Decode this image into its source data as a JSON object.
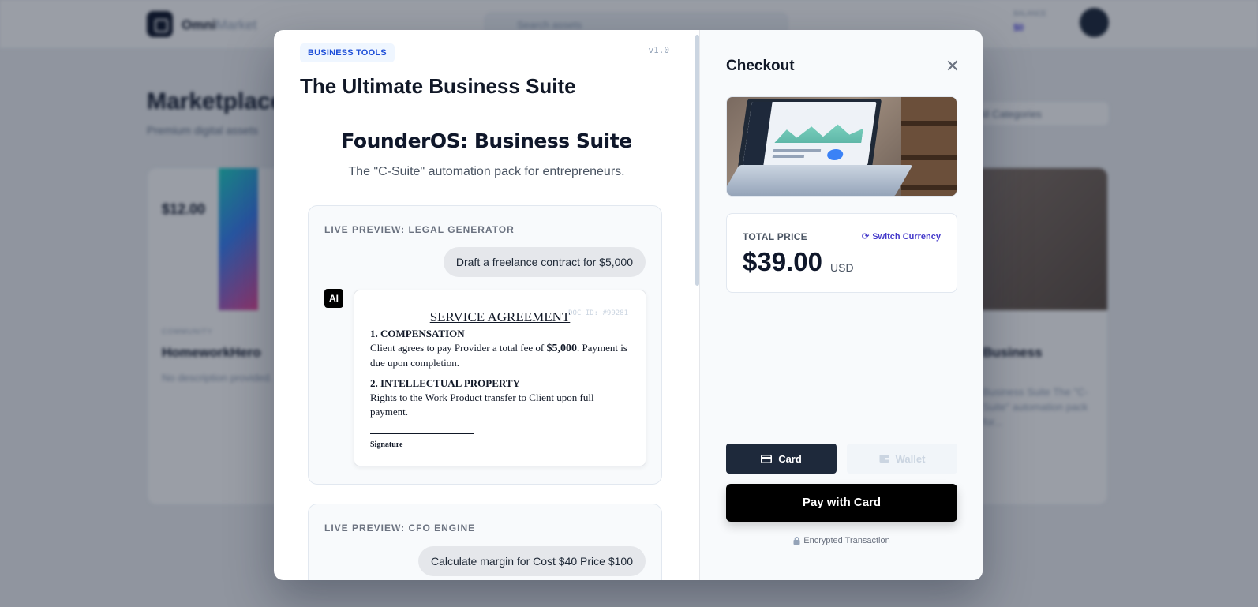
{
  "background": {
    "brand_name": "Omni",
    "brand_suffix": "Market",
    "search_placeholder": "Search assets",
    "balance_label": "BALANCE",
    "balance_value": "$0",
    "page_title": "Marketplace",
    "page_subtitle": "Premium digital assets",
    "category_filter": "All Categories",
    "cards": [
      {
        "category": "COMMUNITY",
        "name": "HomeworkHero",
        "desc": "No description provided.",
        "price": "$12.00"
      },
      {
        "category": "",
        "name": "Business",
        "desc": "Business Suite The \"C-Suite\" automation pack for...",
        "price": ""
      }
    ]
  },
  "modal": {
    "badge": "BUSINESS TOOLS",
    "version": "v1.0",
    "title": "The Ultimate Business Suite",
    "hero_title": "FounderOS: Business Suite",
    "hero_subtitle": "The \"C-Suite\" automation pack for entrepreneurs.",
    "preview1": {
      "label": "LIVE PREVIEW: LEGAL GENERATOR",
      "prompt": "Draft a freelance contract for $5,000",
      "ai_tag": "AI",
      "doc_id": "DOC ID: #99281",
      "doc_title": "SERVICE AGREEMENT",
      "section1_heading": "1. COMPENSATION",
      "section1_text_a": "Client agrees to pay Provider a total fee of ",
      "section1_amount": "$5,000",
      "section1_text_b": ". Payment is due upon completion.",
      "section2_heading": "2. INTELLECTUAL PROPERTY",
      "section2_text": "Rights to the Work Product transfer to Client upon full payment.",
      "signature_label": "Signature"
    },
    "preview2": {
      "label": "LIVE PREVIEW: CFO ENGINE",
      "prompt": "Calculate margin for Cost $40 Price $100"
    }
  },
  "checkout": {
    "title": "Checkout",
    "total_label": "TOTAL PRICE",
    "switch_currency": "Switch Currency",
    "price": "$39.00",
    "currency": "USD",
    "tab_card": "Card",
    "tab_wallet": "Wallet",
    "pay_button": "Pay with Card",
    "secure_note": "Encrypted Transaction"
  },
  "colors": {
    "accent": "#4338ca",
    "badge_text": "#1d4ed8",
    "badge_bg": "#eff6ff",
    "dark": "#1e293b",
    "pay_bg": "#000000"
  }
}
